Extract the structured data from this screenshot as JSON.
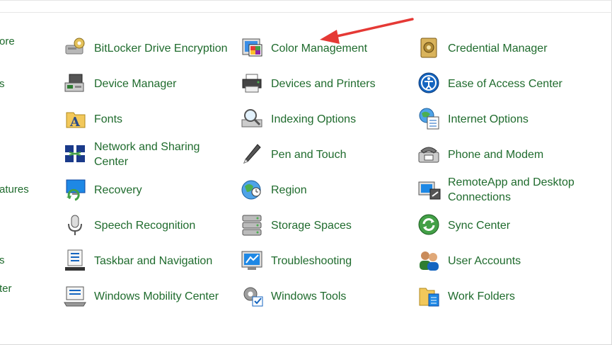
{
  "sidebar": {
    "fragments": [
      "ore",
      "s",
      "atures",
      "s",
      "ter"
    ]
  },
  "items": [
    {
      "label": "BitLocker Drive Encryption",
      "icon": "bitlocker-icon"
    },
    {
      "label": "Color Management",
      "icon": "color-management-icon"
    },
    {
      "label": "Credential Manager",
      "icon": "credential-manager-icon"
    },
    {
      "label": "Device Manager",
      "icon": "device-manager-icon"
    },
    {
      "label": "Devices and Printers",
      "icon": "devices-printers-icon"
    },
    {
      "label": "Ease of Access Center",
      "icon": "ease-of-access-icon"
    },
    {
      "label": "Fonts",
      "icon": "fonts-icon"
    },
    {
      "label": "Indexing Options",
      "icon": "indexing-options-icon"
    },
    {
      "label": "Internet Options",
      "icon": "internet-options-icon"
    },
    {
      "label": "Network and Sharing Center",
      "icon": "network-sharing-icon"
    },
    {
      "label": "Pen and Touch",
      "icon": "pen-touch-icon"
    },
    {
      "label": "Phone and Modem",
      "icon": "phone-modem-icon"
    },
    {
      "label": "Recovery",
      "icon": "recovery-icon"
    },
    {
      "label": "Region",
      "icon": "region-icon"
    },
    {
      "label": "RemoteApp and Desktop Connections",
      "icon": "remoteapp-icon"
    },
    {
      "label": "Speech Recognition",
      "icon": "microphone-icon"
    },
    {
      "label": "Storage Spaces",
      "icon": "storage-spaces-icon"
    },
    {
      "label": "Sync Center",
      "icon": "sync-center-icon"
    },
    {
      "label": "Taskbar and Navigation",
      "icon": "taskbar-icon"
    },
    {
      "label": "Troubleshooting",
      "icon": "troubleshooting-icon"
    },
    {
      "label": "User Accounts",
      "icon": "user-accounts-icon"
    },
    {
      "label": "Windows Mobility Center",
      "icon": "mobility-center-icon"
    },
    {
      "label": "Windows Tools",
      "icon": "windows-tools-icon"
    },
    {
      "label": "Work Folders",
      "icon": "work-folders-icon"
    }
  ],
  "colors": {
    "link_green": "#1f6b2d",
    "annotation_arrow": "#e53935"
  }
}
